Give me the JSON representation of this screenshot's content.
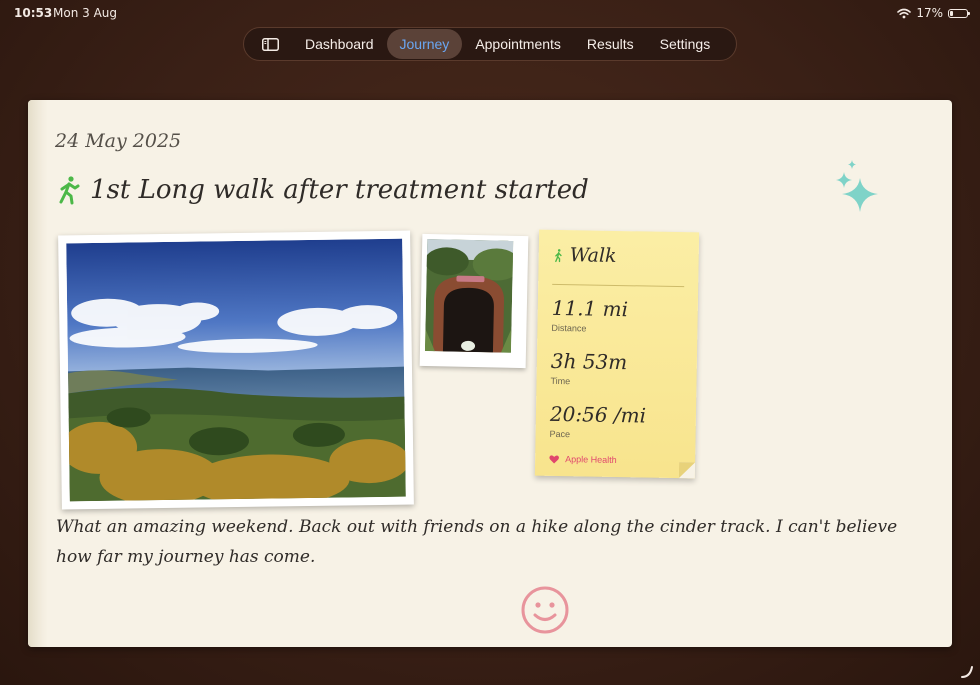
{
  "status_bar": {
    "time": "10:53",
    "date": "Mon 3 Aug",
    "battery": "17%",
    "battery_level": 0.17
  },
  "nav": {
    "tabs": [
      {
        "label": "Dashboard",
        "active": false
      },
      {
        "label": "Journey",
        "active": true
      },
      {
        "label": "Appointments",
        "active": false
      },
      {
        "label": "Results",
        "active": false
      },
      {
        "label": "Settings",
        "active": false
      }
    ]
  },
  "entry": {
    "date": "24 May 2025",
    "title": "1st Long walk after treatment started",
    "body": "What an amazing weekend.  Back out with friends on a hike along the cinder track.  I can't believe how far my journey has come."
  },
  "workout": {
    "type": "Walk",
    "stats": [
      {
        "value": "11.1 mi",
        "label": "Distance"
      },
      {
        "value": "3h 53m",
        "label": "Time"
      },
      {
        "value": "20:56 /mi",
        "label": "Pace"
      }
    ],
    "source": "Apple Health"
  },
  "colors": {
    "accent_tab": "#6aa6f2",
    "walker_icon": "#4cb848",
    "sparkle": "#7fd3c8",
    "smiley": "#e8949c",
    "health_heart": "#e0466c"
  },
  "icons": {
    "sidebar": "sidebar-toggle-icon",
    "walker": "figure-walk-icon",
    "sparkles": "sparkles-icon",
    "heart": "heart-icon",
    "mood": "smiley-face-icon"
  }
}
